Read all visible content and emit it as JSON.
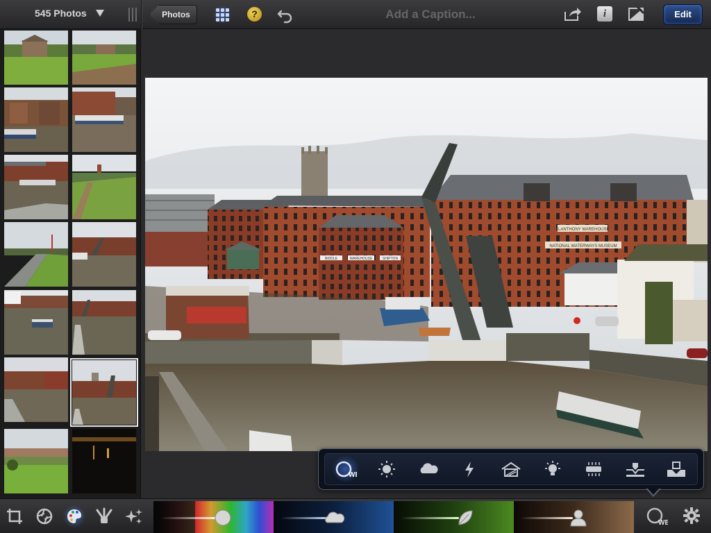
{
  "toolbar": {
    "photo_count": "545 Photos",
    "back_label": "Photos",
    "help_label": "?",
    "caption_placeholder": "Add a Caption...",
    "info_label": "i",
    "edit_label": "Edit"
  },
  "sidebar": {
    "thumbnails": [
      {
        "name": "thumb-1",
        "selected": false
      },
      {
        "name": "thumb-2",
        "selected": false
      },
      {
        "name": "thumb-3",
        "selected": false
      },
      {
        "name": "thumb-4",
        "selected": false
      },
      {
        "name": "thumb-5",
        "selected": false
      },
      {
        "name": "thumb-6",
        "selected": false
      },
      {
        "name": "thumb-7",
        "selected": false
      },
      {
        "name": "thumb-8",
        "selected": false
      },
      {
        "name": "thumb-9",
        "selected": false
      },
      {
        "name": "thumb-10",
        "selected": false
      },
      {
        "name": "thumb-11",
        "selected": false
      },
      {
        "name": "thumb-12",
        "selected": true
      },
      {
        "name": "thumb-13",
        "selected": false
      },
      {
        "name": "thumb-14",
        "selected": false
      }
    ]
  },
  "main_photo": {
    "signs": {
      "warehouse_sign": "LLANTHONY WAREHOUSE",
      "museum_sign": "NATIONAL WATERWAYS MUSEUM",
      "banner_1": "BIDDLE",
      "banner_2": "WAREHOUSE",
      "banner_3": "SHIPTON"
    }
  },
  "adjustments": {
    "items": [
      "white-balance",
      "brightness",
      "weather",
      "flash",
      "shade",
      "incandescent",
      "fluorescent",
      "underwater-1",
      "underwater-2"
    ],
    "active": "white-balance",
    "wb_label": "WB"
  },
  "bottom_tools": [
    "crop",
    "exposure",
    "color",
    "brushes",
    "effects"
  ],
  "active_tool": "color",
  "colors": {
    "accent": "#4f86ff",
    "edit_button": "#1d3a6e",
    "strip_saturation": "#4a4a4a",
    "strip_blue": "#1e4c8a",
    "strip_green": "#3c7a1e",
    "strip_skin": "#7a5a3c"
  }
}
